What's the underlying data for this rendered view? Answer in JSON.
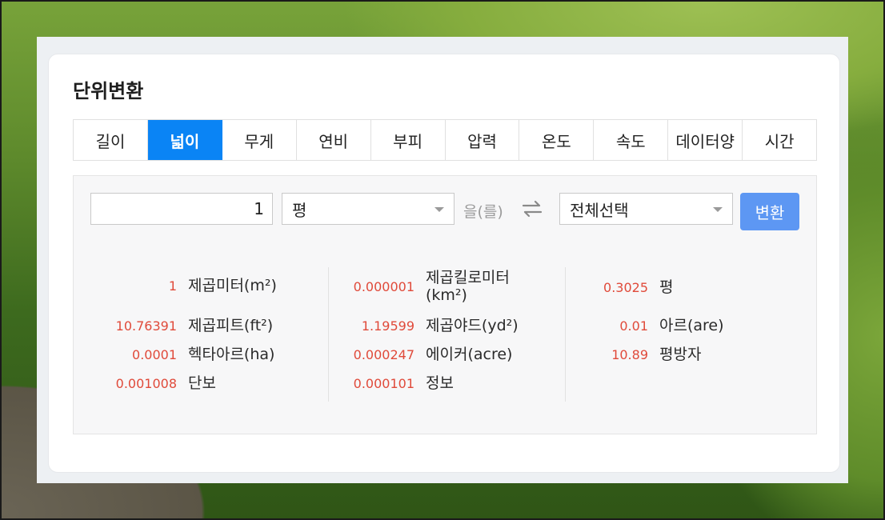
{
  "title": "단위변환",
  "tabs": [
    {
      "label": "길이",
      "active": false
    },
    {
      "label": "넓이",
      "active": true
    },
    {
      "label": "무게",
      "active": false
    },
    {
      "label": "연비",
      "active": false
    },
    {
      "label": "부피",
      "active": false
    },
    {
      "label": "압력",
      "active": false
    },
    {
      "label": "온도",
      "active": false
    },
    {
      "label": "속도",
      "active": false
    },
    {
      "label": "데이터양",
      "active": false
    },
    {
      "label": "시간",
      "active": false
    }
  ],
  "converter": {
    "input_value": "1",
    "from_unit": "평",
    "particle": "을(를)",
    "to_unit": "전체선택",
    "convert_label": "변환"
  },
  "results": {
    "col1": [
      {
        "value": "1",
        "unit": "제곱미터(m²)"
      },
      {
        "value": "10.76391",
        "unit": "제곱피트(ft²)"
      },
      {
        "value": "0.0001",
        "unit": "헥타아르(ha)"
      },
      {
        "value": "0.001008",
        "unit": "단보"
      }
    ],
    "col2": [
      {
        "value": "0.000001",
        "unit": "제곱킬로미터\n(km²)"
      },
      {
        "value": "1.19599",
        "unit": "제곱야드(yd²)"
      },
      {
        "value": "0.000247",
        "unit": "에이커(acre)"
      },
      {
        "value": "0.000101",
        "unit": "정보"
      }
    ],
    "col3": [
      {
        "value": "0.3025",
        "unit": "평"
      },
      {
        "value": "0.01",
        "unit": "아르(are)"
      },
      {
        "value": "10.89",
        "unit": "평방자"
      }
    ]
  },
  "colors": {
    "active_tab": "#0a84f5",
    "convert_button": "#5d97f3",
    "result_value": "#e04a3a"
  }
}
